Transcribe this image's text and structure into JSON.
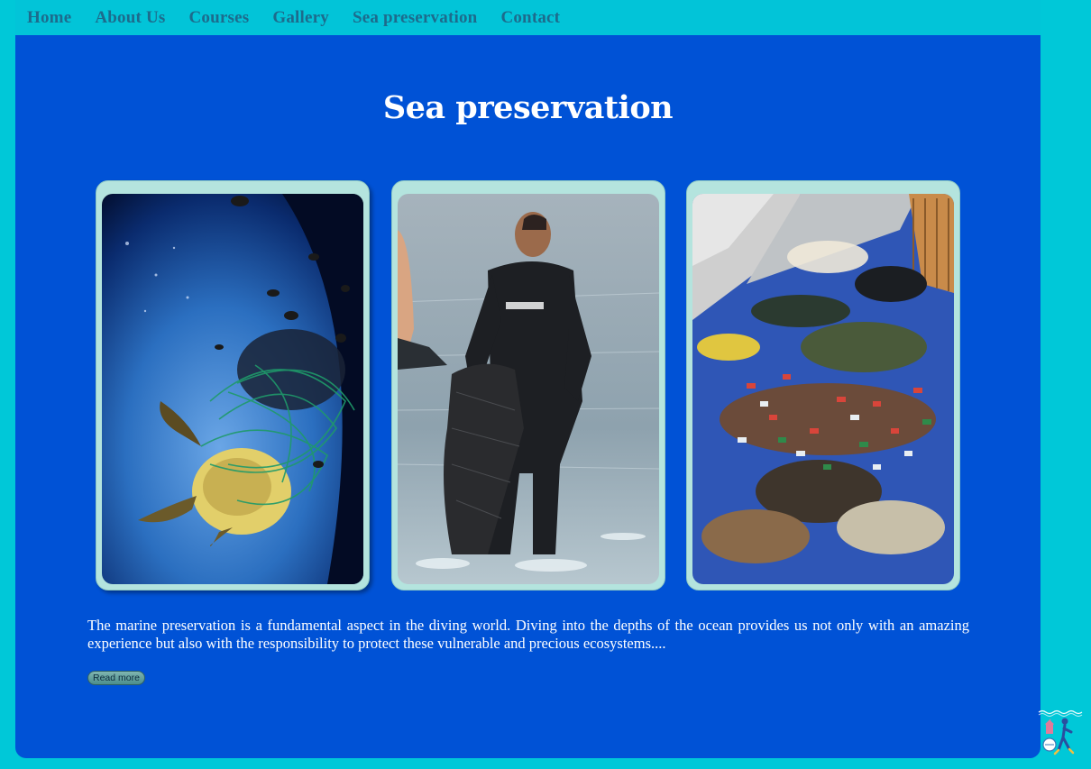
{
  "nav": {
    "items": [
      {
        "label": "Home"
      },
      {
        "label": "About Us"
      },
      {
        "label": "Courses"
      },
      {
        "label": "Gallery"
      },
      {
        "label": "Sea preservation"
      },
      {
        "label": "Contact"
      }
    ]
  },
  "page": {
    "title": "Sea preservation",
    "paragraph": "The marine preservation is a fundamental aspect in the diving world. Diving into the depths of the ocean provides us not only with an amazing experience but also with the responsibility to protect these vulnerable and precious ecosystems....",
    "read_more_label": "Read more"
  },
  "gallery": [
    {
      "subject": "sea turtle tangled in fishing net"
    },
    {
      "subject": "diver in wetsuit carrying recovered net"
    },
    {
      "subject": "collected marine litter on tarp"
    }
  ],
  "colors": {
    "background": "#00c8d8",
    "nav": "#02c4d8",
    "main": "#0052d6",
    "card": "#b4e4de",
    "nav_text": "#1d6b8c"
  }
}
